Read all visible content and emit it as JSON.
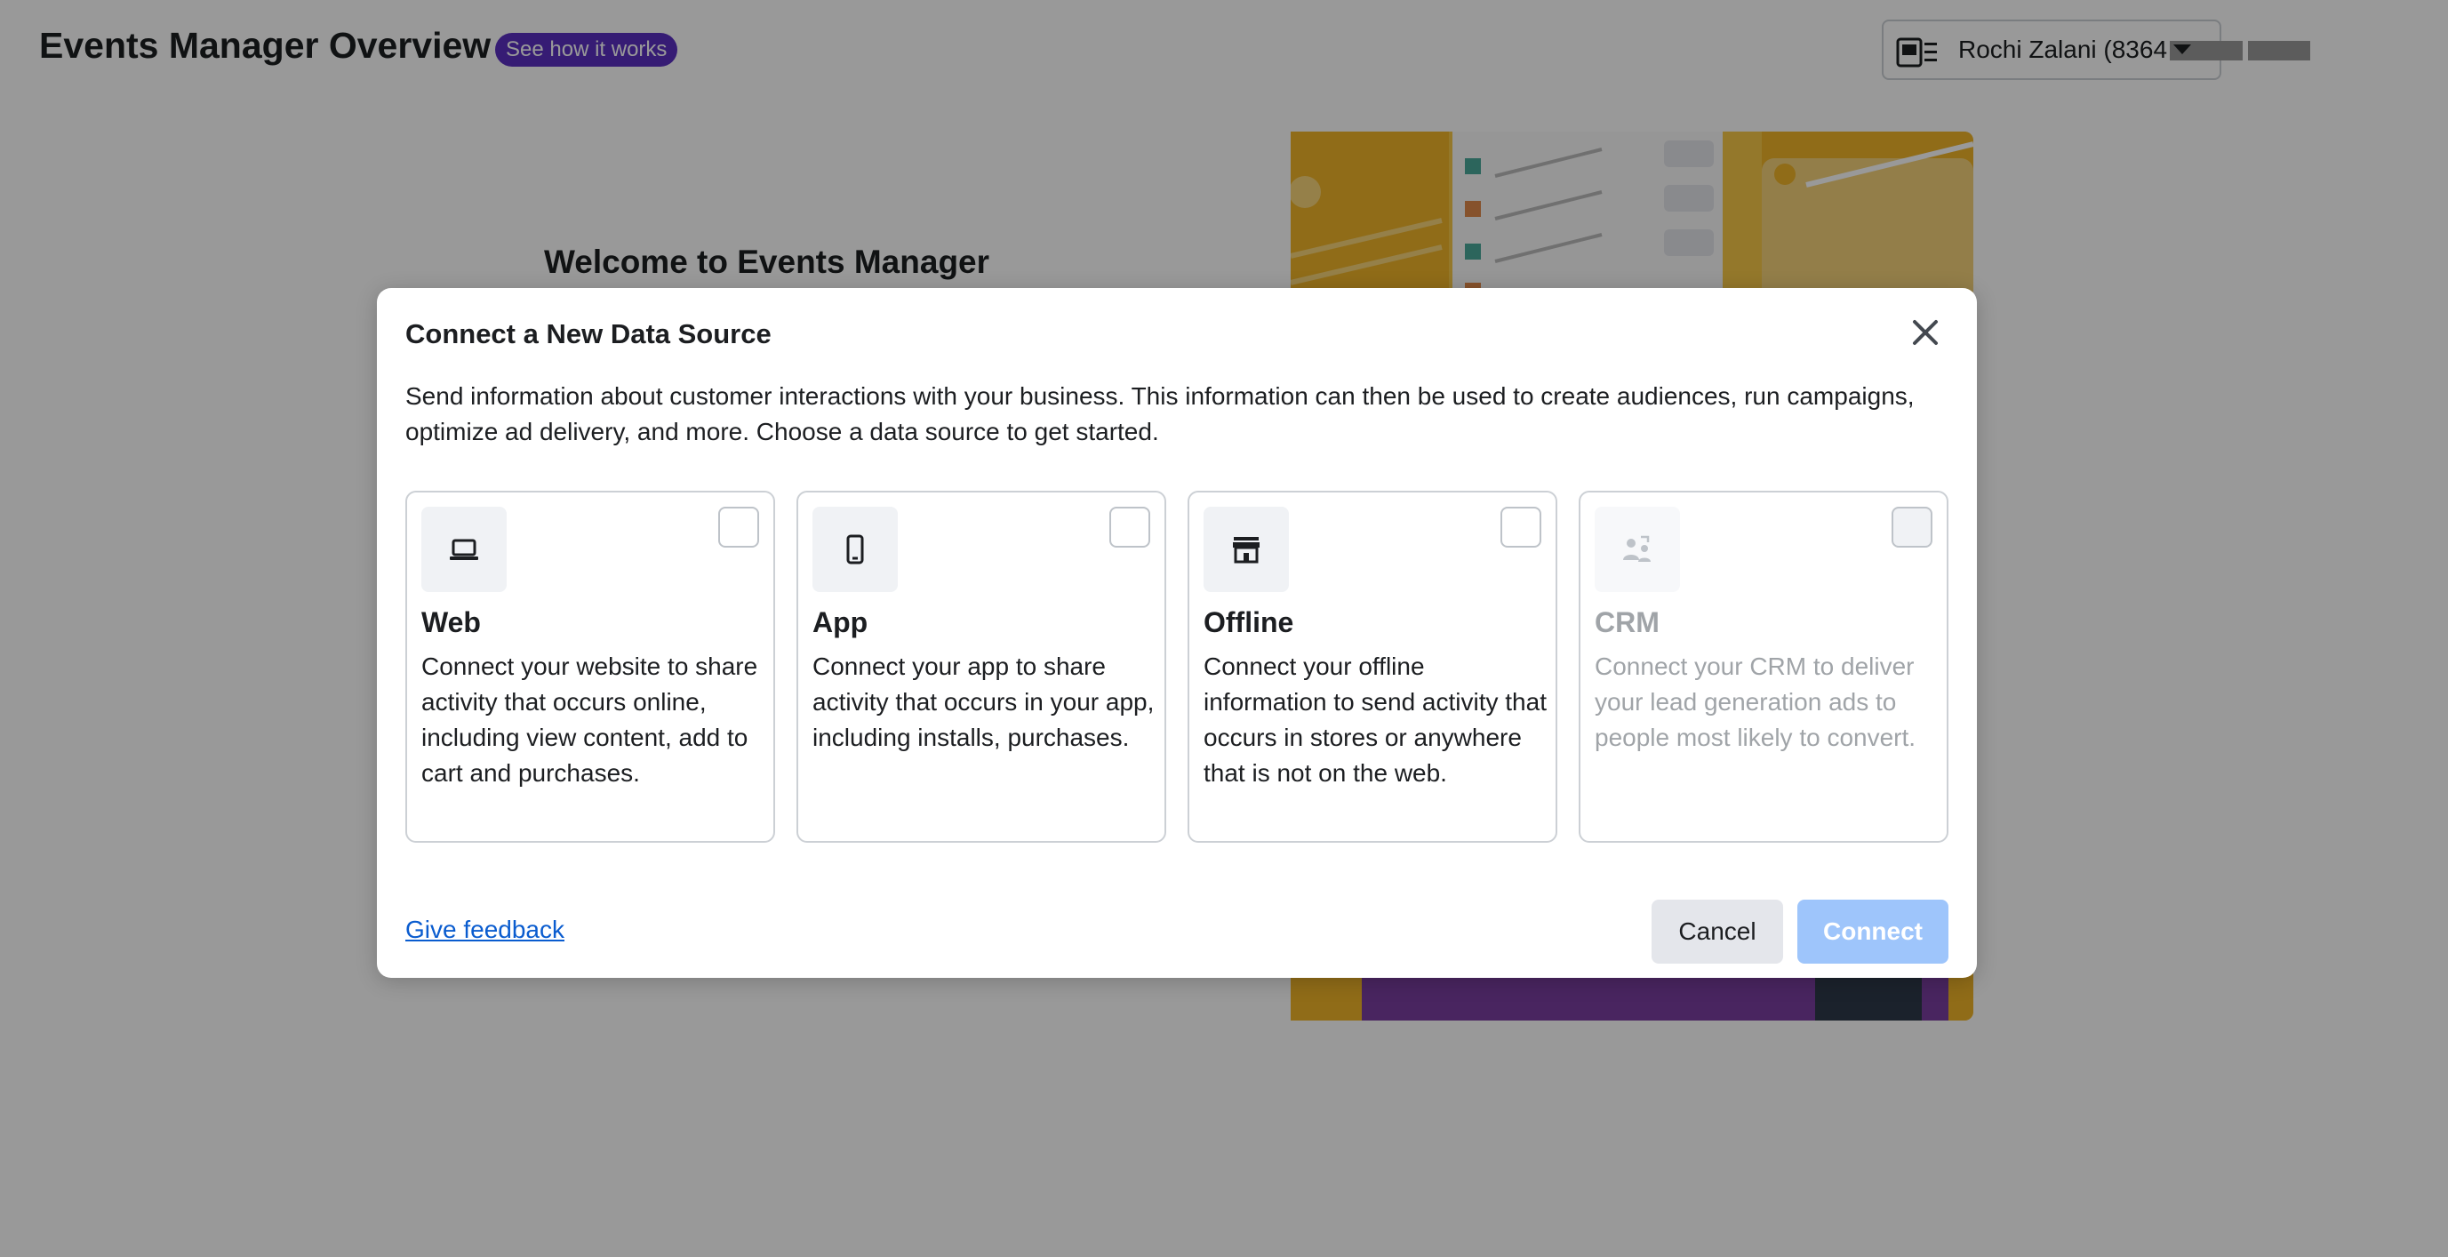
{
  "header": {
    "title": "Events Manager Overview",
    "badge": "See how it works",
    "account": {
      "name": "Rochi Zalani (8364"
    }
  },
  "welcome": {
    "title": "Welcome to Events Manager"
  },
  "modal": {
    "title": "Connect a New Data Source",
    "description": "Send information about customer interactions with your business. This information can then be used to create audiences, run campaigns, optimize ad delivery, and more. Choose a data source to get started.",
    "sources": [
      {
        "title": "Web",
        "description": "Connect your website to share activity that occurs online, including view content, add to cart and purchases.",
        "icon": "laptop-icon",
        "enabled": true
      },
      {
        "title": "App",
        "description": "Connect your app to share activity that occurs in your app, including installs, purchases.",
        "icon": "mobile-phone-icon",
        "enabled": true
      },
      {
        "title": "Offline",
        "description": "Connect your offline information to send activity that occurs in stores or anywhere that is not on the web.",
        "icon": "storefront-icon",
        "enabled": true
      },
      {
        "title": "CRM",
        "description": "Connect your CRM to deliver your lead generation ads to people most likely to convert.",
        "icon": "people-sync-icon",
        "enabled": false
      }
    ],
    "feedback_label": "Give feedback",
    "cancel_label": "Cancel",
    "connect_label": "Connect"
  },
  "colors": {
    "badge": "#5a2fc2",
    "link": "#0a5ccf",
    "connect_disabled": "#9ec5fb",
    "cancel_bg": "#e4e6eb"
  }
}
